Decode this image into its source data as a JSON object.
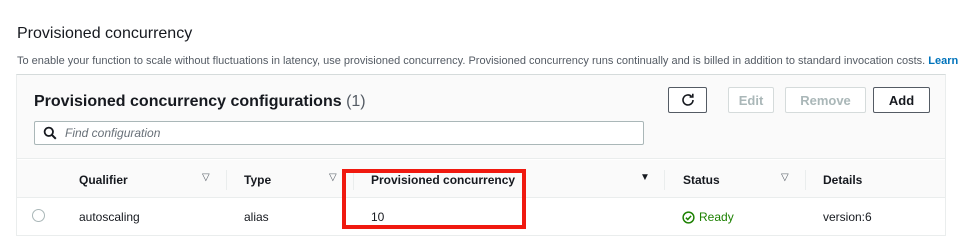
{
  "section": {
    "title": "Provisioned concurrency",
    "description": "To enable your function to scale without fluctuations in latency, use provisioned concurrency. Provisioned concurrency runs continually and is billed in addition to standard invocation costs.",
    "learn_more": "Learn more"
  },
  "panel": {
    "title": "Provisioned concurrency configurations",
    "count": "(1)",
    "buttons": {
      "refresh_icon": "refresh-icon",
      "edit": "Edit",
      "remove": "Remove",
      "add": "Add"
    },
    "search": {
      "placeholder": "Find configuration",
      "value": ""
    }
  },
  "table": {
    "columns": [
      "Qualifier",
      "Type",
      "Provisioned concurrency",
      "Status",
      "Details"
    ],
    "rows": [
      {
        "qualifier": "autoscaling",
        "type": "alias",
        "provisioned_concurrency": "10",
        "status": "Ready",
        "details": "version:6"
      }
    ]
  },
  "colors": {
    "link": "#0073bb",
    "status_ready": "#1d8102",
    "highlight": "#f0190f"
  }
}
